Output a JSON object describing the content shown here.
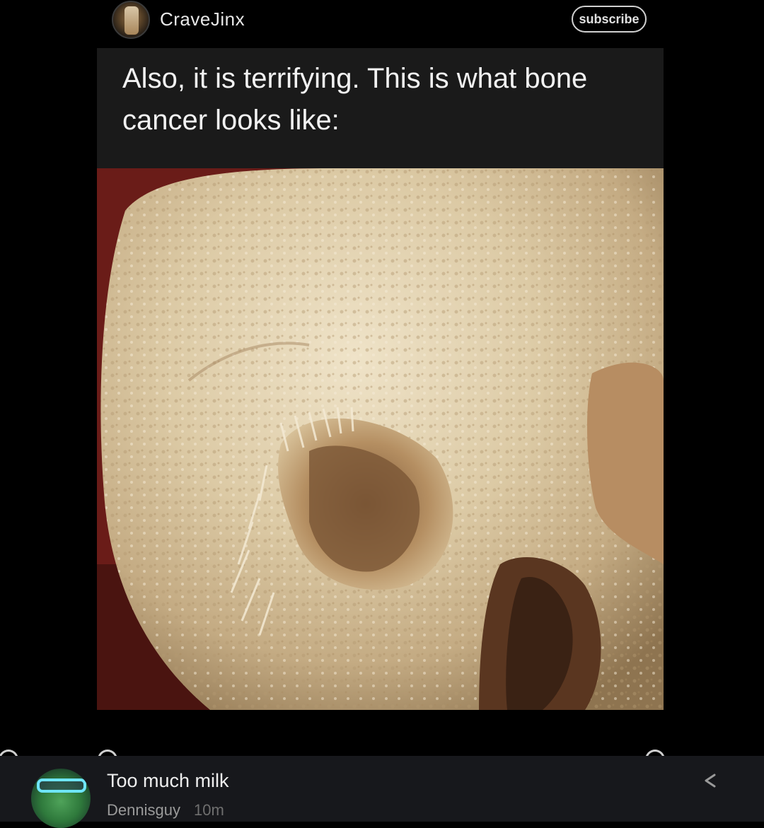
{
  "post": {
    "author": "CraveJinx",
    "subscribe_label": "subscribe",
    "caption": "Also, it is terrifying. This is what bone cancer looks like:"
  },
  "comment": {
    "text": "Too much milk",
    "user": "Dennisguy",
    "time": "10m"
  },
  "icons": {
    "share": "share-icon",
    "avatar_top": "user-avatar",
    "avatar_bottom": "commenter-avatar"
  },
  "colors": {
    "background": "#000000",
    "caption_bg": "#1a1a1a",
    "comment_bar_bg": "#17181c"
  }
}
